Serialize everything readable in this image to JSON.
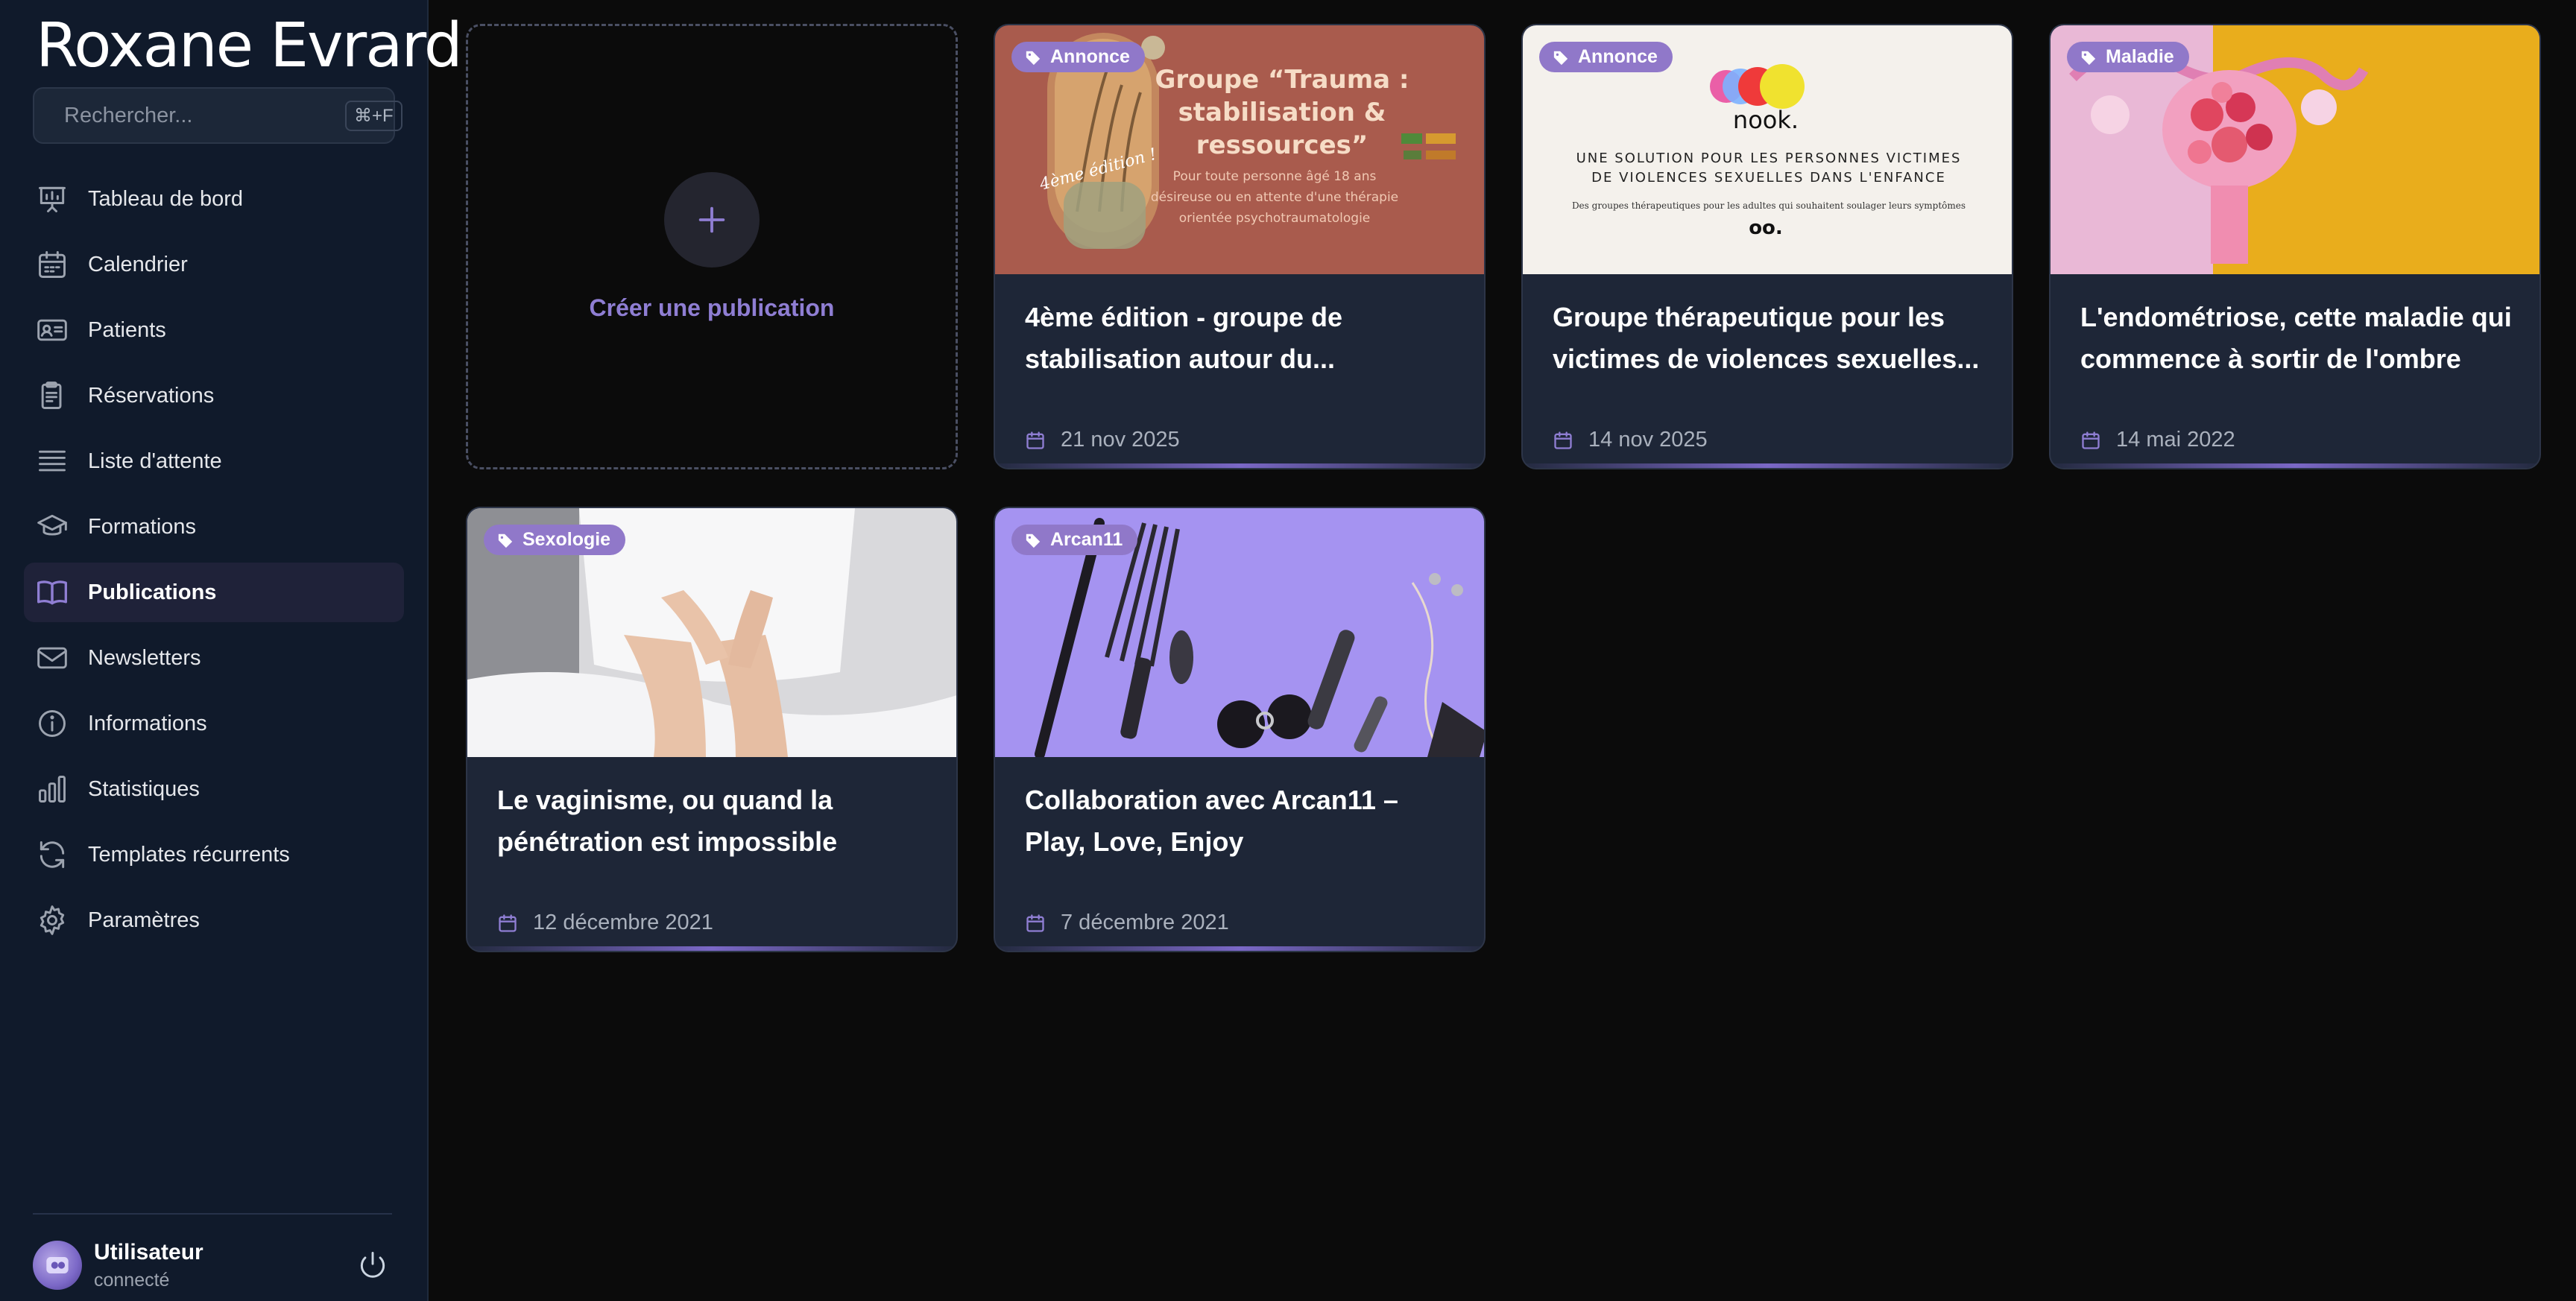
{
  "brand": "Roxane Evrard",
  "search": {
    "placeholder": "Rechercher...",
    "shortcut": "⌘+F"
  },
  "nav": [
    {
      "label": "Tableau de bord",
      "icon": "dashboard-icon"
    },
    {
      "label": "Calendrier",
      "icon": "calendar-icon"
    },
    {
      "label": "Patients",
      "icon": "id-card-icon"
    },
    {
      "label": "Réservations",
      "icon": "clipboard-icon"
    },
    {
      "label": "Liste d'attente",
      "icon": "list-icon"
    },
    {
      "label": "Formations",
      "icon": "graduation-cap-icon"
    },
    {
      "label": "Publications",
      "icon": "book-open-icon",
      "active": true
    },
    {
      "label": "Newsletters",
      "icon": "mail-icon"
    },
    {
      "label": "Informations",
      "icon": "info-icon"
    },
    {
      "label": "Statistiques",
      "icon": "bar-chart-icon"
    },
    {
      "label": "Templates récurrents",
      "icon": "refresh-icon"
    },
    {
      "label": "Paramètres",
      "icon": "gear-icon"
    }
  ],
  "user": {
    "name": "Utilisateur",
    "status": "connecté"
  },
  "create_label": "Créer une publication",
  "publications": [
    {
      "tag": "Annonce",
      "title": "4ème édition - groupe de stabilisation autour du...",
      "date": "21 nov 2025",
      "image": {
        "headline": "Groupe “Trauma : stabilisation & ressources”",
        "line1": "Pour toute personne âgé 18 ans",
        "line2": "désireuse ou en attente d'une thérapie",
        "line3": "orientée psychotraumatologie",
        "badge": "4ème édition !"
      }
    },
    {
      "tag": "Annonce",
      "title": "Groupe thérapeutique pour les victimes de violences sexuelles...",
      "date": "14 nov 2025",
      "image": {
        "logo": "nook.",
        "line1": "UNE SOLUTION POUR LES PERSONNES VICTIMES",
        "line2": "DE VIOLENCES SEXUELLES DANS L'ENFANCE",
        "line3": "Des groupes thérapeutiques pour les adultes qui souhaitent soulager leurs symptômes",
        "mark": "oo."
      }
    },
    {
      "tag": "Maladie",
      "title": "L'endométriose, cette maladie qui commence à sortir de l'ombre",
      "date": "14 mai 2022"
    },
    {
      "tag": "Sexologie",
      "title": "Le vaginisme, ou quand la pénétration est impossible",
      "date": "12 décembre 2021"
    },
    {
      "tag": "Arcan11",
      "title": "Collaboration avec Arcan11 – Play, Love, Enjoy",
      "date": "7 décembre 2021"
    }
  ],
  "colors": {
    "accent": "#9078c9",
    "sidebar": "#101a2b",
    "card": "#1e2637",
    "background": "#0b0b0b"
  }
}
